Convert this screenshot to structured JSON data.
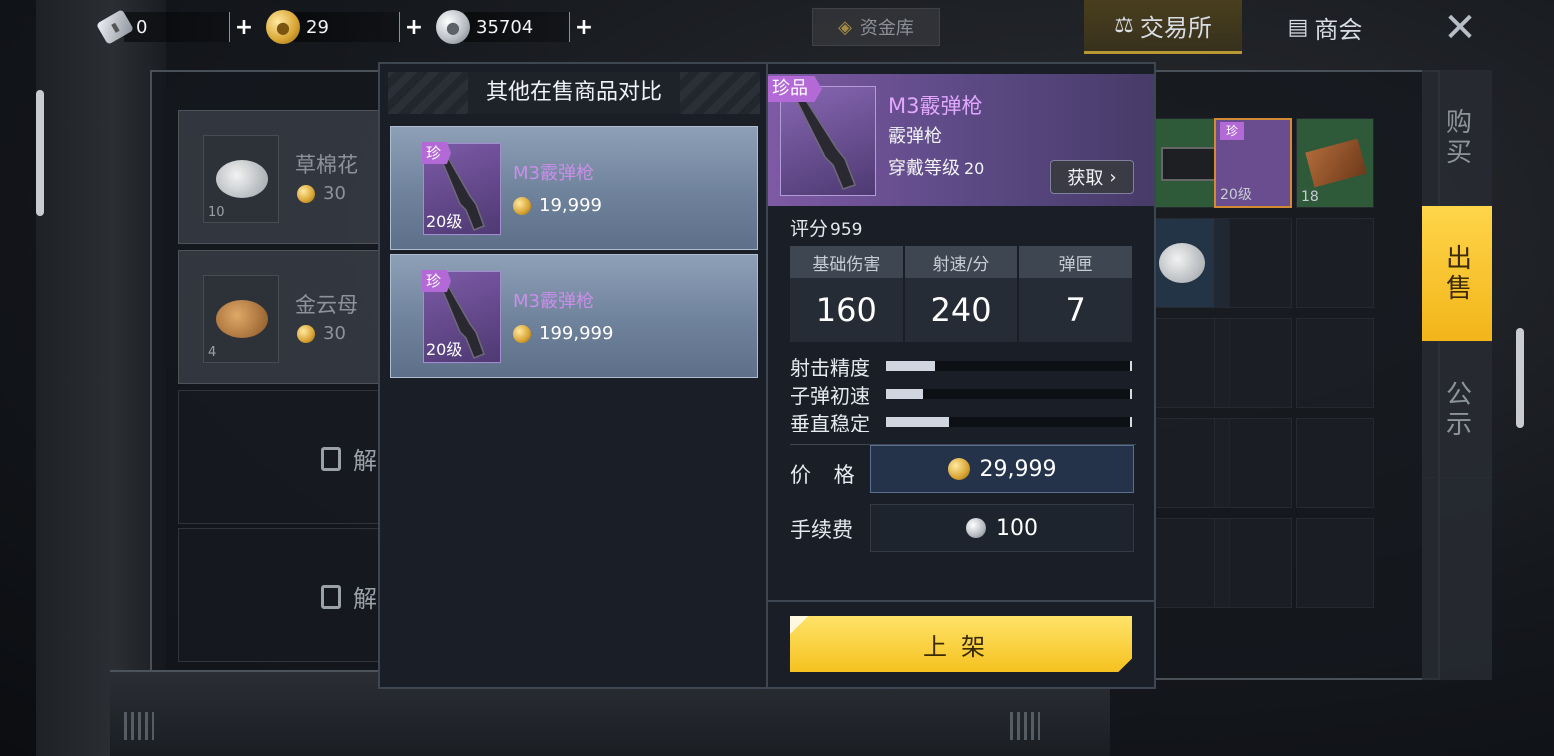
{
  "currencies": [
    {
      "icon": "ticket-icon",
      "value": "0"
    },
    {
      "icon": "gold-coin-icon",
      "value": "29"
    },
    {
      "icon": "silver-coin-icon",
      "value": "35704"
    }
  ],
  "header": {
    "vault_label": "资金库",
    "tab_exchange": "交易所",
    "tab_guild": "商会",
    "close_icon": "close-icon"
  },
  "side_tabs": [
    {
      "label": "购买",
      "active": false
    },
    {
      "label": "出售",
      "active": true
    },
    {
      "label": "公示",
      "active": false
    }
  ],
  "background_list": [
    {
      "name": "草棉花",
      "price": "30",
      "count": "10",
      "icon": "cotton-icon"
    },
    {
      "name": "金云母",
      "price": "30",
      "count": "4",
      "icon": "ore-icon"
    }
  ],
  "locked_label": "解",
  "background_grid_counts": {
    "weapon_level": "20级",
    "wood": "18"
  },
  "comparison": {
    "title": "其他在售商品对比",
    "items": [
      {
        "rarity": "珍",
        "level": "20级",
        "name": "M3霰弹枪",
        "price": "19,999"
      },
      {
        "rarity": "珍",
        "level": "20级",
        "name": "M3霰弹枪",
        "price": "199,999"
      }
    ]
  },
  "detail": {
    "rarity": "珍品",
    "name": "M3霰弹枪",
    "type": "霰弹枪",
    "equip_level_label": "穿戴等级",
    "equip_level": "20",
    "obtain_label": "获取",
    "score_label": "评分",
    "score": "959",
    "stats": [
      {
        "label": "基础伤害",
        "value": "160"
      },
      {
        "label": "射速/分",
        "value": "240"
      },
      {
        "label": "弹匣",
        "value": "7"
      }
    ],
    "bars": [
      {
        "label": "射击精度",
        "fraction": 0.2
      },
      {
        "label": "子弹初速",
        "fraction": 0.15
      },
      {
        "label": "垂直稳定",
        "fraction": 0.26
      }
    ],
    "price_label": "价 格",
    "price": "29,999",
    "fee_label": "手续费",
    "fee": "100",
    "list_button": "上架"
  },
  "colors": {
    "accent_gold": "#f5c21f",
    "rare_purple": "#b36ad6",
    "rare_name": "#e2a7ff"
  }
}
